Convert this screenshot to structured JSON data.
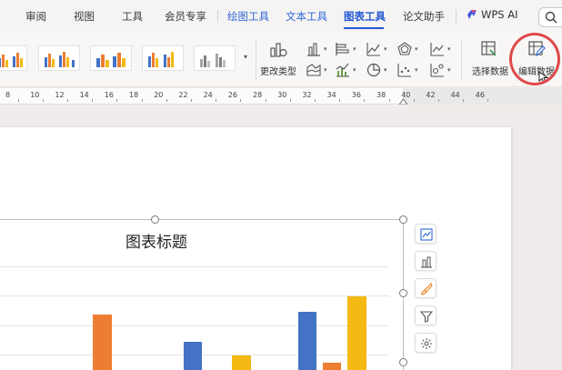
{
  "tabs": [
    {
      "label": "审阅",
      "state": "normal"
    },
    {
      "label": "视图",
      "state": "normal"
    },
    {
      "label": "工具",
      "state": "normal"
    },
    {
      "label": "会员专享",
      "state": "normal"
    },
    {
      "label": "绘图工具",
      "state": "contextual"
    },
    {
      "label": "文本工具",
      "state": "contextual"
    },
    {
      "label": "图表工具",
      "state": "active"
    },
    {
      "label": "论文助手",
      "state": "normal"
    }
  ],
  "wps_ai": {
    "label": "WPS AI"
  },
  "ribbon": {
    "change_type": "更改类型",
    "select_data": "选择数据",
    "edit_data": "编辑数据"
  },
  "ruler": {
    "numbers": [
      "8",
      "10",
      "12",
      "14",
      "16",
      "18",
      "20",
      "22",
      "24",
      "26",
      "28",
      "30",
      "32",
      "34",
      "36",
      "38",
      "40",
      "42",
      "44",
      "46"
    ]
  },
  "chart": {
    "title": "图表标题"
  },
  "colors": {
    "accent": "#2358d4",
    "series_blue": "#4472c4",
    "series_orange": "#ed7d31",
    "series_yellow": "#f4b913",
    "highlight_ring": "#e0484a"
  },
  "icons": {
    "search": "search-icon",
    "chart_elements": "chart-elements-icon",
    "chart_style": "chart-style-icon",
    "chart_brush": "brush-icon",
    "chart_filter": "filter-icon",
    "chart_settings": "gear-icon"
  }
}
